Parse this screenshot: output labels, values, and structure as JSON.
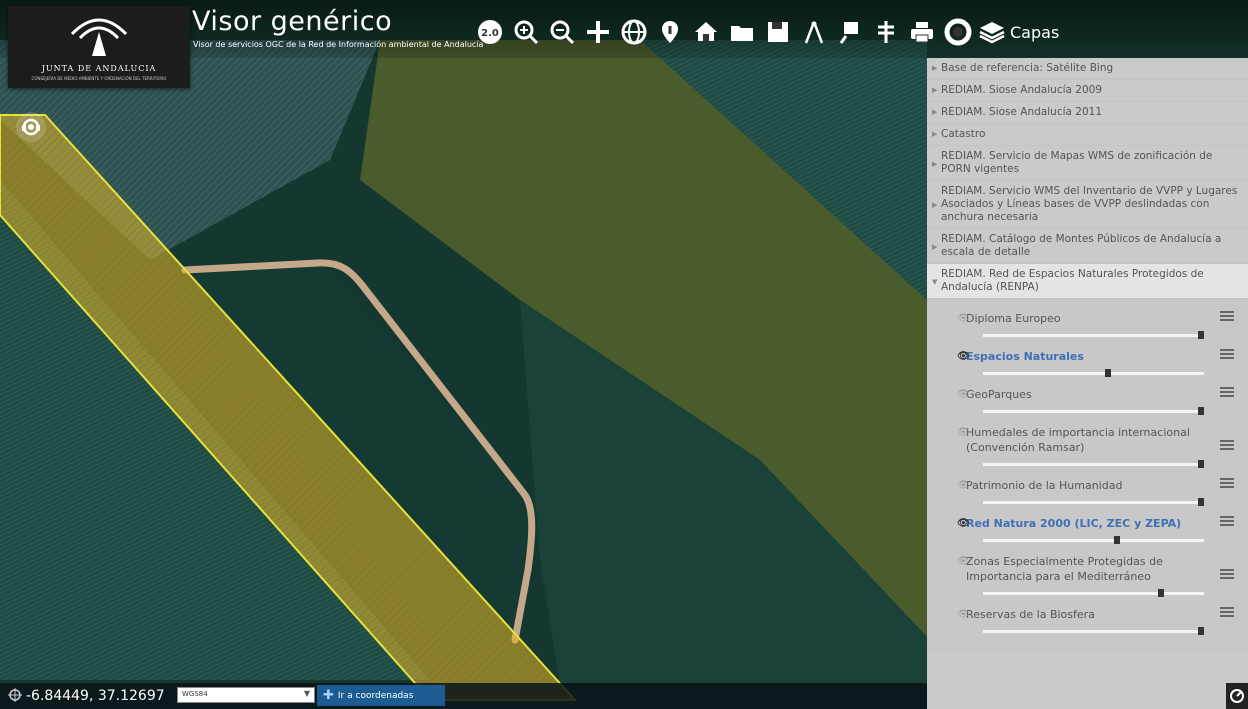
{
  "header": {
    "logo_text": "JUNTA DE ANDALUCIA",
    "logo_subtext": "CONSEJERÍA DE MEDIO AMBIENTE Y ORDENACIÓN DEL TERRITORIO",
    "title": "Visor genérico",
    "subtitle": "Visor de servicios OGC de la Red de Información ambiental de Andalucía"
  },
  "toolbar": {
    "tools": [
      "version-badge-icon",
      "zoom-in-icon",
      "zoom-out-icon",
      "pan-icon",
      "globe-icon",
      "info-pin-icon",
      "home-icon",
      "folder-icon",
      "save-icon",
      "measure-icon",
      "draw-icon",
      "road-icon",
      "print-icon",
      "help-icon"
    ],
    "version_label": "2.0",
    "layers_label": "Capas"
  },
  "panel": {
    "groups_closed": [
      "Base de referencia: Satélite Bing",
      "REDIAM. Siose Andalucía 2009",
      "REDIAM. Siose Andalucía 2011",
      "Catastro",
      "REDIAM. Servicio de Mapas WMS de zonificación de PORN vigentes",
      "REDIAM. Servicio WMS del Inventario de VVPP y Lugares Asociados y Líneas bases de VVPP deslindadas con anchura necesaria",
      "REDIAM. Catálogo de Montes Públicos de Andalucía a escala de detalle"
    ],
    "group_open": "REDIAM. Red de Espacios Naturales Protegidos de Andalucía (RENPA)",
    "layers": [
      {
        "name": "Diploma Europeo",
        "visible": false,
        "opacity": 1.0
      },
      {
        "name": "Espacios Naturales",
        "visible": true,
        "opacity": 0.58
      },
      {
        "name": "GeoParques",
        "visible": false,
        "opacity": 1.0
      },
      {
        "name": "Humedales de importancia internacional (Convención Ramsar)",
        "visible": false,
        "opacity": 1.0
      },
      {
        "name": "Patrimonio de la Humanidad",
        "visible": false,
        "opacity": 1.0
      },
      {
        "name": "Red Natura 2000 (LIC, ZEC y ZEPA)",
        "visible": true,
        "opacity": 0.62
      },
      {
        "name": "Zonas Especialmente Protegidas de Importancia para el Mediterráneo",
        "visible": false,
        "opacity": 0.82
      },
      {
        "name": "Reservas de la Biosfera",
        "visible": false,
        "opacity": 1.0
      }
    ]
  },
  "bottombar": {
    "coordinates": "-6.84449, 37.12697",
    "srs_value": "WGS84",
    "goto_label": "Ir a coordenadas"
  },
  "colors": {
    "accent": "#1d5c93",
    "visible_layer": "#3f6fb5",
    "overlay_yellow": "#e8c23a"
  }
}
